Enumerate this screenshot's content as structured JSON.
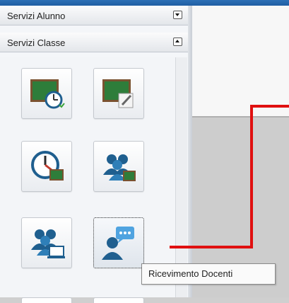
{
  "accordion": {
    "alunno": {
      "label": "Servizi Alunno"
    },
    "classe": {
      "label": "Servizi Classe"
    }
  },
  "tiles": [
    {
      "icon": "chalkboard-clock-icon"
    },
    {
      "icon": "chalkboard-edit-icon"
    },
    {
      "icon": "clock-chalkboard-icon"
    },
    {
      "icon": "group-chalkboard-icon"
    },
    {
      "icon": "group-computer-icon"
    },
    {
      "icon": "person-chat-icon",
      "tooltip": "Ricevimento Docenti"
    }
  ],
  "colors": {
    "accent_red": "#e01010",
    "chalkboard_green": "#2e7d3a",
    "frame_brown": "#7a5230",
    "icon_blue": "#1f5f8f"
  }
}
